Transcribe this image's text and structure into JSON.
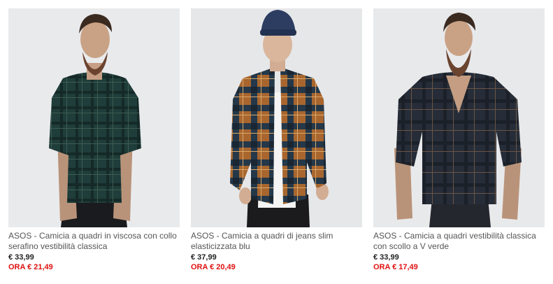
{
  "products": [
    {
      "title": "ASOS - Camicia a quadri in viscosa con collo serafino vestibilità classica",
      "price": "€ 33,99",
      "sale_price": "ORA € 21,49",
      "image": "model-green-check-grandad-shirt"
    },
    {
      "title": "ASOS - Camicia a quadri di jeans slim elasticizzata blu",
      "price": "€ 37,99",
      "sale_price": "ORA € 20,49",
      "image": "model-orange-blue-check-shirt-beanie"
    },
    {
      "title": "ASOS - Camicia a quadri vestibilità classica con scollo a V verde",
      "price": "€ 33,99",
      "sale_price": "ORA € 17,49",
      "image": "model-dark-check-v-neck-shirt"
    }
  ],
  "colors": {
    "sale": "#e01010",
    "price": "#222222",
    "title": "#555555",
    "photo_bg": "#e9eaec"
  }
}
